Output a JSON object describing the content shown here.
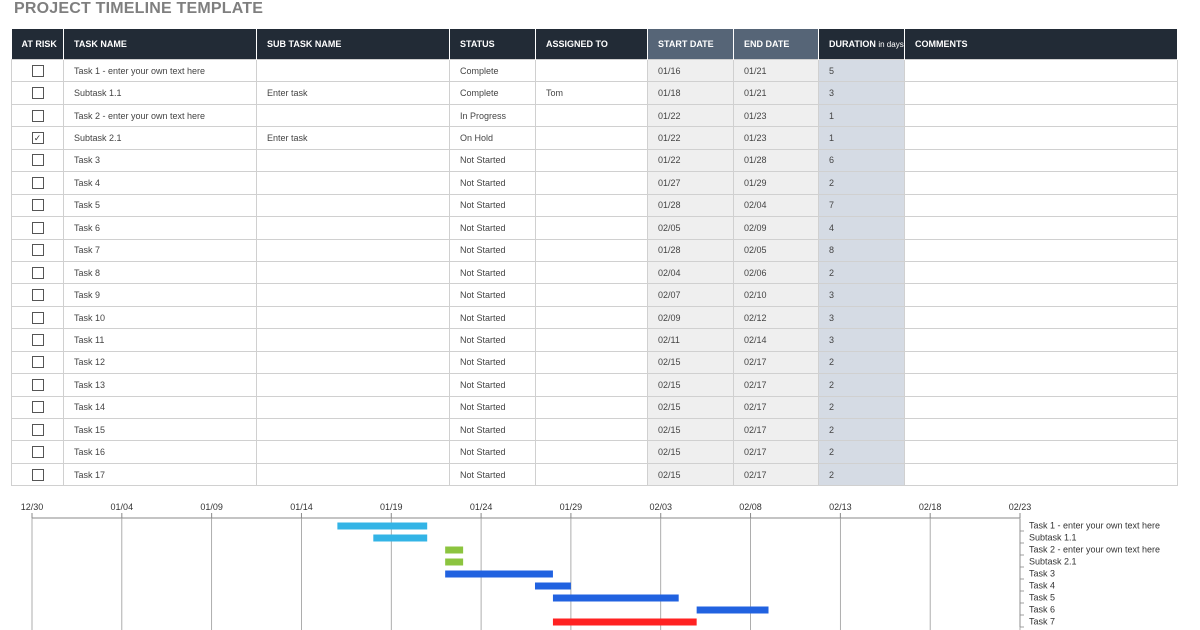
{
  "title": "PROJECT TIMELINE TEMPLATE",
  "headers": {
    "at_risk": "AT RISK",
    "task_name": "TASK NAME",
    "sub_task_name": "SUB TASK NAME",
    "status": "STATUS",
    "assigned_to": "ASSIGNED TO",
    "start_date": "START DATE",
    "end_date": "END DATE",
    "duration": "DURATION",
    "duration_unit": "in days",
    "comments": "COMMENTS"
  },
  "rows": [
    {
      "at_risk": false,
      "task": "Task 1 - enter your own text here",
      "subtask": "",
      "status": "Complete",
      "assigned": "",
      "start": "01/16",
      "end": "01/21",
      "duration": "5",
      "comments": ""
    },
    {
      "at_risk": false,
      "task": "Subtask 1.1",
      "subtask": "Enter task",
      "status": "Complete",
      "assigned": "Tom",
      "start": "01/18",
      "end": "01/21",
      "duration": "3",
      "comments": ""
    },
    {
      "at_risk": false,
      "task": "Task 2 - enter your own text here",
      "subtask": "",
      "status": "In Progress",
      "assigned": "",
      "start": "01/22",
      "end": "01/23",
      "duration": "1",
      "comments": ""
    },
    {
      "at_risk": true,
      "task": "Subtask 2.1",
      "subtask": "Enter task",
      "status": "On Hold",
      "assigned": "",
      "start": "01/22",
      "end": "01/23",
      "duration": "1",
      "comments": ""
    },
    {
      "at_risk": false,
      "task": "Task 3",
      "subtask": "",
      "status": "Not Started",
      "assigned": "",
      "start": "01/22",
      "end": "01/28",
      "duration": "6",
      "comments": ""
    },
    {
      "at_risk": false,
      "task": "Task 4",
      "subtask": "",
      "status": "Not Started",
      "assigned": "",
      "start": "01/27",
      "end": "01/29",
      "duration": "2",
      "comments": ""
    },
    {
      "at_risk": false,
      "task": "Task 5",
      "subtask": "",
      "status": "Not Started",
      "assigned": "",
      "start": "01/28",
      "end": "02/04",
      "duration": "7",
      "comments": ""
    },
    {
      "at_risk": false,
      "task": "Task 6",
      "subtask": "",
      "status": "Not Started",
      "assigned": "",
      "start": "02/05",
      "end": "02/09",
      "duration": "4",
      "comments": ""
    },
    {
      "at_risk": false,
      "task": "Task 7",
      "subtask": "",
      "status": "Not Started",
      "assigned": "",
      "start": "01/28",
      "end": "02/05",
      "duration": "8",
      "comments": ""
    },
    {
      "at_risk": false,
      "task": "Task 8",
      "subtask": "",
      "status": "Not Started",
      "assigned": "",
      "start": "02/04",
      "end": "02/06",
      "duration": "2",
      "comments": ""
    },
    {
      "at_risk": false,
      "task": "Task 9",
      "subtask": "",
      "status": "Not Started",
      "assigned": "",
      "start": "02/07",
      "end": "02/10",
      "duration": "3",
      "comments": ""
    },
    {
      "at_risk": false,
      "task": "Task 10",
      "subtask": "",
      "status": "Not Started",
      "assigned": "",
      "start": "02/09",
      "end": "02/12",
      "duration": "3",
      "comments": ""
    },
    {
      "at_risk": false,
      "task": "Task 11",
      "subtask": "",
      "status": "Not Started",
      "assigned": "",
      "start": "02/11",
      "end": "02/14",
      "duration": "3",
      "comments": ""
    },
    {
      "at_risk": false,
      "task": "Task 12",
      "subtask": "",
      "status": "Not Started",
      "assigned": "",
      "start": "02/15",
      "end": "02/17",
      "duration": "2",
      "comments": ""
    },
    {
      "at_risk": false,
      "task": "Task 13",
      "subtask": "",
      "status": "Not Started",
      "assigned": "",
      "start": "02/15",
      "end": "02/17",
      "duration": "2",
      "comments": ""
    },
    {
      "at_risk": false,
      "task": "Task 14",
      "subtask": "",
      "status": "Not Started",
      "assigned": "",
      "start": "02/15",
      "end": "02/17",
      "duration": "2",
      "comments": ""
    },
    {
      "at_risk": false,
      "task": "Task 15",
      "subtask": "",
      "status": "Not Started",
      "assigned": "",
      "start": "02/15",
      "end": "02/17",
      "duration": "2",
      "comments": ""
    },
    {
      "at_risk": false,
      "task": "Task 16",
      "subtask": "",
      "status": "Not Started",
      "assigned": "",
      "start": "02/15",
      "end": "02/17",
      "duration": "2",
      "comments": ""
    },
    {
      "at_risk": false,
      "task": "Task 17",
      "subtask": "",
      "status": "Not Started",
      "assigned": "",
      "start": "02/15",
      "end": "02/17",
      "duration": "2",
      "comments": ""
    }
  ],
  "colors": {
    "header_bg": "#222b36",
    "date_header_bg": "#566577",
    "date_cell_bg": "#efefef",
    "duration_cell_bg": "#d5dbe4",
    "complete": "#33b4e6",
    "in_progress_on_hold": "#8cc43f",
    "not_started": "#2162e0",
    "at_risk": "#ff2222"
  },
  "chart_data": {
    "type": "bar",
    "orientation": "horizontal",
    "x_ticks": [
      "12/30",
      "01/04",
      "01/09",
      "01/14",
      "01/19",
      "01/24",
      "01/29",
      "02/03",
      "02/08",
      "02/13",
      "02/18",
      "02/23"
    ],
    "x_range": [
      "12/30",
      "02/23"
    ],
    "categories": [
      "Task 1 - enter your own text here",
      "Subtask 1.1",
      "Task 2 - enter your own text here",
      "Subtask 2.1",
      "Task 3",
      "Task 4",
      "Task 5",
      "Task 6",
      "Task 7"
    ],
    "bars": [
      {
        "start": "01/16",
        "end": "01/21",
        "color": "#33b4e6"
      },
      {
        "start": "01/18",
        "end": "01/21",
        "color": "#33b4e6"
      },
      {
        "start": "01/22",
        "end": "01/23",
        "color": "#8cc43f"
      },
      {
        "start": "01/22",
        "end": "01/23",
        "color": "#8cc43f"
      },
      {
        "start": "01/22",
        "end": "01/28",
        "color": "#2162e0"
      },
      {
        "start": "01/27",
        "end": "01/29",
        "color": "#2162e0"
      },
      {
        "start": "01/28",
        "end": "02/04",
        "color": "#2162e0"
      },
      {
        "start": "02/05",
        "end": "02/09",
        "color": "#2162e0"
      },
      {
        "start": "01/28",
        "end": "02/05",
        "color": "#ff2222"
      }
    ],
    "grid": true,
    "legend": "none"
  }
}
